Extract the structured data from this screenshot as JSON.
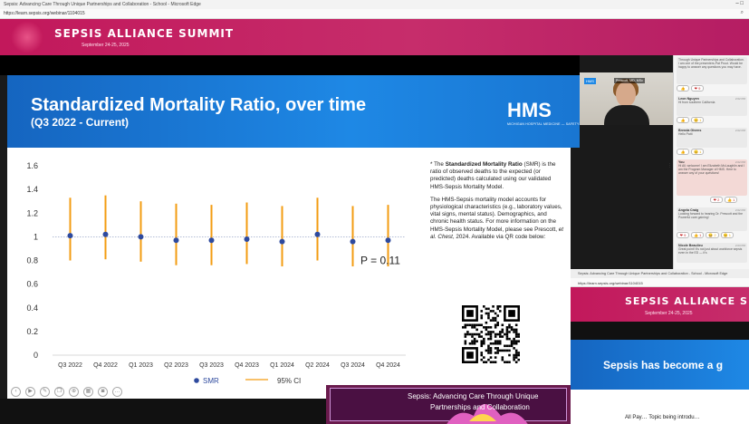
{
  "browser": {
    "title": "Sepsis: Advancing Care Through Unique Partnerships and Collaboration - School - Microsoft Edge",
    "url": "https://learn.sepsis.org/webinar/1104015",
    "window_controls": "– □"
  },
  "banner": {
    "title": "SEPSIS ALLIANCE SUMMIT",
    "date": "September 24-25, 2025"
  },
  "slide": {
    "title": "Standardized Mortality Ratio, over time",
    "subtitle": "(Q3 2022 - Current)",
    "logo_big": "HMS",
    "logo_small": "MICHIGAN HOSPITAL MEDICINE — SAFETY CONSORTIUM —",
    "note1_pre": "* The ",
    "note1_bold": "Standardized Mortality Ratio",
    "note1_post": " (SMR) is the ratio of observed deaths to the expected (or predicted) deaths calculated using our validated HMS-Sepsis Mortality Model.",
    "note2_pre": "The HMS-Sepsis mortality model accounts for physiological characteristics (e.g., laboratory values, vital signs, mental status). Demographics, and chronic health status. For more information on the HMS-Sepsis Mortality Model, please see Prescott, ",
    "note2_em": "et al. Chest",
    "note2_post": ", 2024. Available via QR code below:"
  },
  "chart_data": {
    "type": "scatter",
    "categories": [
      "Q3 2022",
      "Q4 2022",
      "Q1 2023",
      "Q2 2023",
      "Q3 2023",
      "Q4 2023",
      "Q1 2024",
      "Q2 2024",
      "Q3 2024",
      "Q4 2024"
    ],
    "series": [
      {
        "name": "SMR",
        "values": [
          1.01,
          1.02,
          1.0,
          0.97,
          0.97,
          0.98,
          0.96,
          1.02,
          0.96,
          0.97
        ]
      },
      {
        "name": "95% CI",
        "lower": [
          0.8,
          0.81,
          0.79,
          0.76,
          0.76,
          0.77,
          0.75,
          0.8,
          0.75,
          0.75
        ],
        "upper": [
          1.33,
          1.35,
          1.3,
          1.28,
          1.27,
          1.29,
          1.26,
          1.33,
          1.26,
          1.27
        ]
      }
    ],
    "yticks": [
      "1.6",
      "1.4",
      "1.2",
      "1",
      "0.8",
      "0.6",
      "0.4",
      "0.2",
      "0"
    ],
    "ylim": [
      0,
      1.6
    ],
    "reference_line": 1.0,
    "annotation": "P = 0.11",
    "legend": {
      "smr": "SMR",
      "ci": "95% CI"
    },
    "colors": {
      "smr": "#2e4a9e",
      "ci": "#f39c12",
      "reference": "#9aa8c8"
    }
  },
  "webcam": {
    "tag": "HMS",
    "name": "Prescott, MD, MSc"
  },
  "chat": {
    "messages": [
      {
        "who": "",
        "time": "",
        "text": "Through Unique Partnerships and Collaboration. I am one of the presenters-Pat Prout. Would be happy to answer any questions you may have.",
        "reacts": [
          "👍",
          "❤ 9"
        ]
      },
      {
        "who": "Leon Nguyen",
        "time": "2:02 PM",
        "text": "Hi from southern California",
        "reacts": [
          "👍",
          "😊 1"
        ]
      },
      {
        "who": "Brenda Givens",
        "time": "2:02 PM",
        "text": "Hello Patti",
        "reacts": [
          "👍",
          "😊 1"
        ]
      },
      {
        "who": "You",
        "time": "2:02 PM",
        "text": "Hi All, welcome! I am Elizabeth McLaughlin and I am the Program Manager of HMS. Here to answer any of your questions!",
        "reacts": [
          "❤ 2",
          "👍 1"
        ]
      },
      {
        "who": "Angela Craig",
        "time": "2:02 PM",
        "text": "Looking forward to hearing Dr. Prescott and the Powerful care gaining!",
        "reacts": [
          "❤ 9",
          "👍 1",
          "😀 2",
          "😊 1"
        ]
      },
      {
        "who": "Nicole Beaulieu",
        "time": "2:03 PM",
        "text": "Great point! It's not just about workforce sepsis even in the ED — it's",
        "reacts": []
      }
    ]
  },
  "win2": {
    "title": "Sepsis: Advancing Care Through Unique Partnerships and Collaboration - School - Microsoft Edge",
    "url": "https://learn.sepsis.org/webinar/1104015",
    "banner_title": "SEPSIS ALLIANCE SUMMIT",
    "banner_date": "September 24-25, 2025",
    "slide_text": "Sepsis has become a g",
    "footer_text": "All Pay… Topic being introdu…"
  },
  "bottom": {
    "line1": "Sepsis: Advancing Care Through Unique",
    "line2": "Partnerships and Collaboration"
  }
}
